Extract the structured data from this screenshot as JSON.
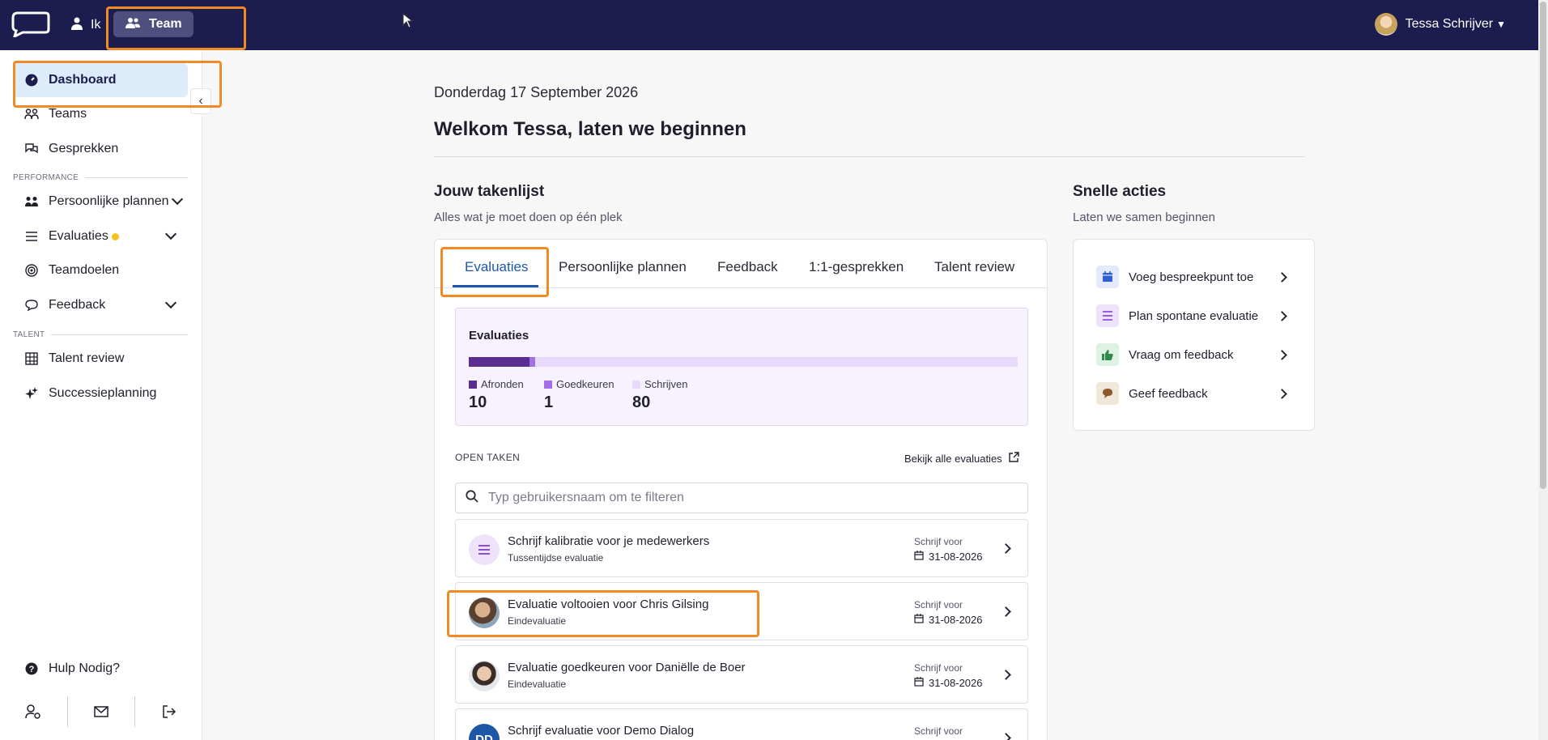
{
  "topbar": {
    "nav_ik": "Ik",
    "nav_team": "Team",
    "user_name": "Tessa Schrijver"
  },
  "sidebar": {
    "items": [
      {
        "label": "Dashboard",
        "icon": "dashboard-icon"
      },
      {
        "label": "Teams",
        "icon": "teams-icon"
      },
      {
        "label": "Gesprekken",
        "icon": "chat-icon"
      },
      {
        "label": "Persoonlijke plannen",
        "icon": "people-icon"
      },
      {
        "label": "Evaluaties",
        "icon": "list-icon"
      },
      {
        "label": "Teamdoelen",
        "icon": "target-icon"
      },
      {
        "label": "Feedback",
        "icon": "speech-icon"
      },
      {
        "label": "Talent review",
        "icon": "grid-icon"
      },
      {
        "label": "Successieplanning",
        "icon": "sparkle-icon"
      }
    ],
    "section_performance": "PERFORMANCE",
    "section_talent": "TALENT",
    "help": "Hulp Nodig?"
  },
  "main": {
    "date": "Donderdag 17 September 2026",
    "welcome": "Welkom Tessa, laten we beginnen",
    "tasklist_title": "Jouw takenlijst",
    "tasklist_sub": "Alles wat je moet doen op één plek",
    "quick_title": "Snelle acties",
    "quick_sub": "Laten we samen beginnen"
  },
  "tabs": [
    "Evaluaties",
    "Persoonlijke plannen",
    "Feedback",
    "1:1-gesprekken",
    "Talent review"
  ],
  "stats": {
    "title": "Evaluaties",
    "items": [
      {
        "label": "Afronden",
        "value": "10",
        "color": "#5b2c91"
      },
      {
        "label": "Goedkeuren",
        "value": "1",
        "color": "#a36ee6"
      },
      {
        "label": "Schrijven",
        "value": "80",
        "color": "#e8dafa"
      }
    ]
  },
  "open_tasks": {
    "label": "OPEN TAKEN",
    "view_all": "Bekijk alle evaluaties",
    "search_placeholder": "Typ gebruikersnaam om te filteren",
    "tasks": [
      {
        "title": "Schrijf kalibratie voor je medewerkers",
        "subtitle": "Tussentijdse evaluatie",
        "due_label": "Schrijf voor",
        "due": "31-08-2026"
      },
      {
        "title": "Evaluatie voltooien voor Chris Gilsing",
        "subtitle": "Eindevaluatie",
        "due_label": "Schrijf voor",
        "due": "31-08-2026"
      },
      {
        "title": "Evaluatie goedkeuren voor Daniëlle de Boer",
        "subtitle": "Eindevaluatie",
        "due_label": "Schrijf voor",
        "due": "31-08-2026"
      },
      {
        "title": "Schrijf evaluatie voor Demo Dialog",
        "subtitle": "",
        "due_label": "Schrijf voor",
        "due": "",
        "initials": "DD"
      }
    ]
  },
  "quick_actions": [
    {
      "label": "Voeg bespreekpunt toe",
      "icon": "calendar-icon",
      "color": "#2f5fd0"
    },
    {
      "label": "Plan spontane evaluatie",
      "icon": "list-icon",
      "color": "#8a4fd6"
    },
    {
      "label": "Vraag om feedback",
      "icon": "thumbs-up-icon",
      "color": "#2f8a4a"
    },
    {
      "label": "Geef feedback",
      "icon": "speech-icon",
      "color": "#8a5a2b"
    }
  ]
}
